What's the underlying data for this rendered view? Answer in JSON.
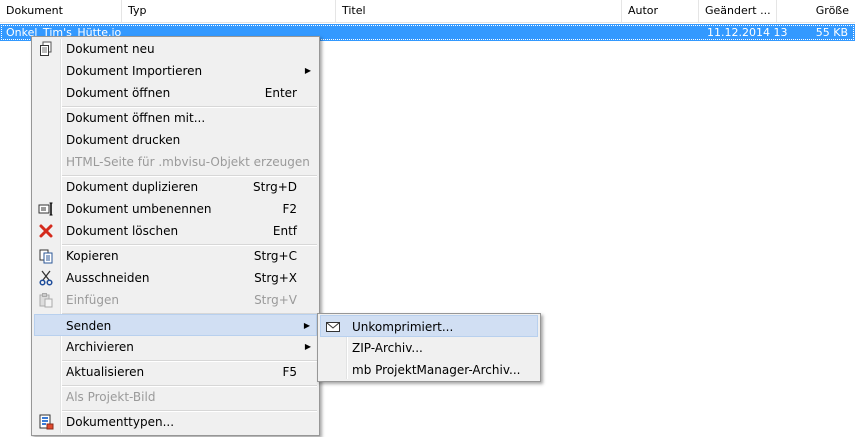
{
  "columns": [
    {
      "key": "dokument",
      "label": "Dokument"
    },
    {
      "key": "typ",
      "label": "Typ"
    },
    {
      "key": "titel",
      "label": "Titel"
    },
    {
      "key": "autor",
      "label": "Autor"
    },
    {
      "key": "geaendert",
      "label": "Geändert ..."
    },
    {
      "key": "groesse",
      "label": "Größe"
    }
  ],
  "selected_row": {
    "name": "Onkel_Tim's_Hütte.io",
    "modified": "11.12.2014 13",
    "size": "55 KB"
  },
  "context_menu": {
    "items": [
      {
        "label": "Dokument neu",
        "shortcut": "",
        "icon": "new-document-icon",
        "disabled": false,
        "submenu": false
      },
      {
        "label": "Dokument Importieren",
        "shortcut": "",
        "icon": "",
        "disabled": false,
        "submenu": true
      },
      {
        "label": "Dokument öffnen",
        "shortcut": "Enter",
        "icon": "",
        "disabled": false,
        "submenu": false
      },
      {
        "label": "Dokument öffnen mit...",
        "shortcut": "",
        "icon": "",
        "disabled": false,
        "submenu": false
      },
      {
        "label": "Dokument drucken",
        "shortcut": "",
        "icon": "",
        "disabled": false,
        "submenu": false
      },
      {
        "label": "HTML-Seite für .mbvisu-Objekt erzeugen",
        "shortcut": "",
        "icon": "",
        "disabled": true,
        "submenu": false
      },
      {
        "label": "Dokument duplizieren",
        "shortcut": "Strg+D",
        "icon": "",
        "disabled": false,
        "submenu": false
      },
      {
        "label": "Dokument umbenennen",
        "shortcut": "F2",
        "icon": "rename-icon",
        "disabled": false,
        "submenu": false
      },
      {
        "label": "Dokument löschen",
        "shortcut": "Entf",
        "icon": "delete-icon",
        "disabled": false,
        "submenu": false
      },
      {
        "label": "Kopieren",
        "shortcut": "Strg+C",
        "icon": "copy-icon",
        "disabled": false,
        "submenu": false
      },
      {
        "label": "Ausschneiden",
        "shortcut": "Strg+X",
        "icon": "cut-icon",
        "disabled": false,
        "submenu": false
      },
      {
        "label": "Einfügen",
        "shortcut": "Strg+V",
        "icon": "paste-icon",
        "disabled": true,
        "submenu": false
      },
      {
        "label": "Senden",
        "shortcut": "",
        "icon": "",
        "disabled": false,
        "submenu": true,
        "highlighted": true
      },
      {
        "label": "Archivieren",
        "shortcut": "",
        "icon": "",
        "disabled": false,
        "submenu": true
      },
      {
        "label": "Aktualisieren",
        "shortcut": "F5",
        "icon": "",
        "disabled": false,
        "submenu": false
      },
      {
        "label": "Als Projekt-Bild",
        "shortcut": "",
        "icon": "",
        "disabled": true,
        "submenu": false
      },
      {
        "label": "Dokumenttypen...",
        "shortcut": "",
        "icon": "document-types-icon",
        "disabled": false,
        "submenu": false
      }
    ]
  },
  "send_submenu": {
    "items": [
      {
        "label": "Unkomprimiert...",
        "icon": "envelope-icon",
        "highlighted": true
      },
      {
        "label": "ZIP-Archiv...",
        "icon": ""
      },
      {
        "label": "mb ProjektManager-Archiv...",
        "icon": ""
      }
    ]
  },
  "colors": {
    "selection": "#3399ff",
    "menu_bg": "#f0f0f0",
    "menu_highlight": "#d1dff3",
    "disabled_text": "#9a9a9a",
    "delete_red": "#d42a1c"
  }
}
